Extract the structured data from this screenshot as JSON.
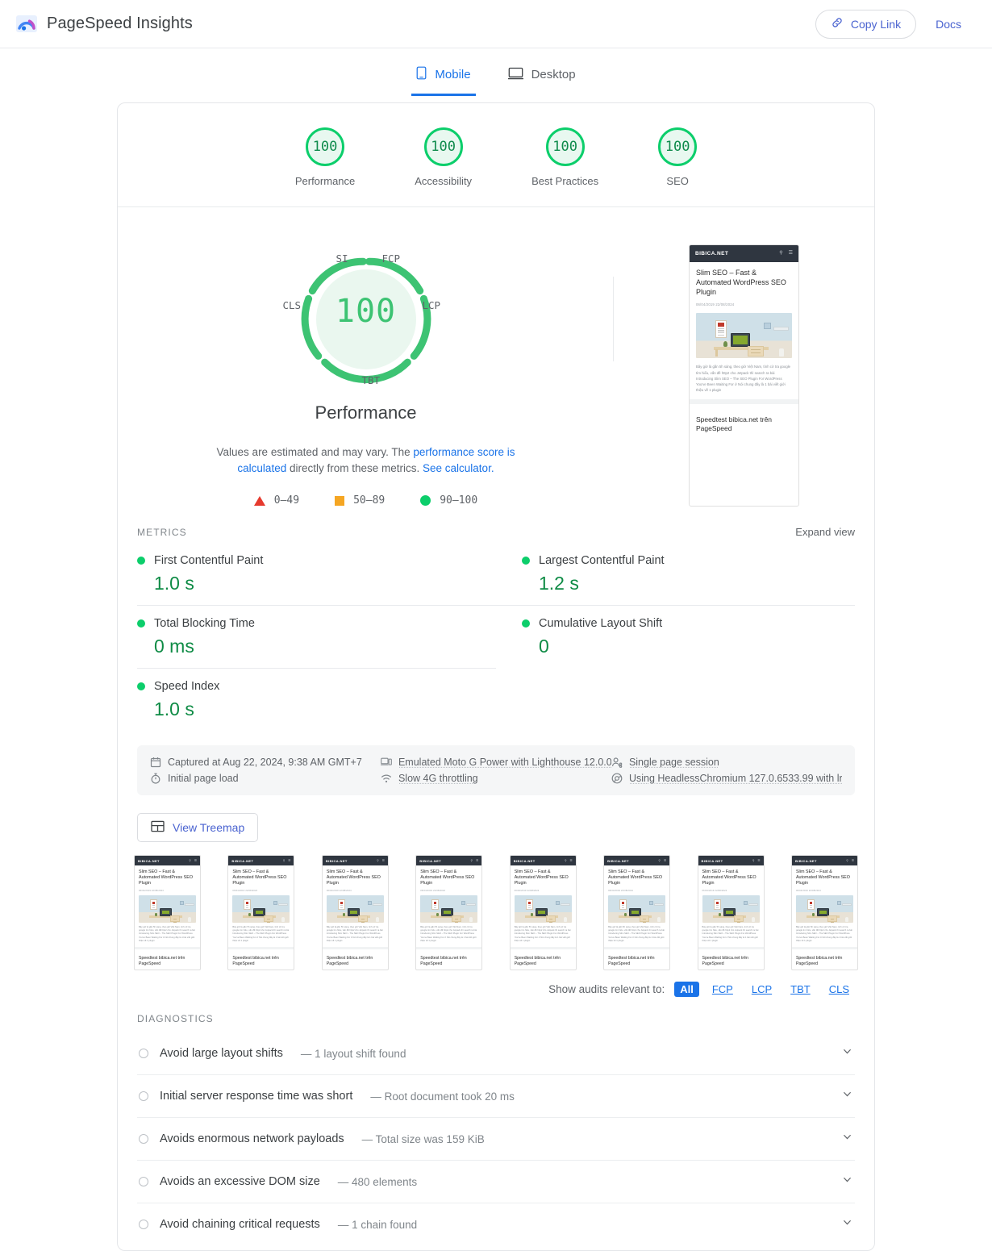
{
  "header": {
    "app_title": "PageSpeed Insights",
    "logo_icon": "pagespeed-logo-icon",
    "copy_link_label": "Copy Link",
    "copy_link_icon": "link-icon",
    "docs_label": "Docs"
  },
  "device_tabs": [
    {
      "label": "Mobile",
      "icon": "mobile-phone-icon",
      "active": true
    },
    {
      "label": "Desktop",
      "icon": "desktop-monitor-icon",
      "active": false
    }
  ],
  "category_scores": [
    {
      "label": "Performance",
      "score": "100"
    },
    {
      "label": "Accessibility",
      "score": "100"
    },
    {
      "label": "Best Practices",
      "score": "100"
    },
    {
      "label": "SEO",
      "score": "100"
    }
  ],
  "performance_gauge": {
    "score": "100",
    "title": "Performance",
    "arc_labels": {
      "si": "SI",
      "fcp": "FCP",
      "lcp": "LCP",
      "tbt": "TBT",
      "cls": "CLS"
    },
    "note_prefix": "Values are estimated and may vary. The ",
    "note_link1": "performance score is calculated",
    "note_middle": " directly from these metrics. ",
    "note_link2": "See calculator.",
    "legend": [
      {
        "symbol": "triangle",
        "range": "0–49",
        "color": "#e63a2e"
      },
      {
        "symbol": "square",
        "range": "50–89",
        "color": "#f5a623"
      },
      {
        "symbol": "circle",
        "range": "90–100",
        "color": "#0cce6b"
      }
    ]
  },
  "site_thumbnail": {
    "brand": "BIBICA.NET",
    "search_icon": "search-icon",
    "menu_icon": "hamburger-menu-icon",
    "title": "Slim SEO – Fast & Automated WordPress SEO Plugin",
    "meta": "06/04/2019  22/08/2024",
    "excerpt": "Bây giờ là gần 5h sáng, theo giờ Việt Nam, tình cờ tra google tìm hiểu, vấn đề http2 cho Jetpack thì search ra bài Introducing Slim SEO – The SEO Plugin For WordPress You've Been Waiting For ớ Nói chung đây là 1 bài viết giới thiệu về 1 plugin",
    "footer": "Speedtest bibica.net trên PageSpeed"
  },
  "metrics": {
    "section_label": "METRICS",
    "expand_view_label": "Expand view",
    "items": [
      {
        "name": "First Contentful Paint",
        "value": "1.0 s",
        "status": "good"
      },
      {
        "name": "Largest Contentful Paint",
        "value": "1.2 s",
        "status": "good"
      },
      {
        "name": "Total Blocking Time",
        "value": "0 ms",
        "status": "good"
      },
      {
        "name": "Cumulative Layout Shift",
        "value": "0",
        "status": "good"
      },
      {
        "name": "Speed Index",
        "value": "1.0 s",
        "status": "good"
      }
    ]
  },
  "environment": [
    {
      "icon": "calendar-icon",
      "text": "Captured at Aug 22, 2024, 9:38 AM GMT+7",
      "underlined": false
    },
    {
      "icon": "device-icon",
      "text": "Emulated Moto G Power with Lighthouse 12.0.0",
      "underlined": true
    },
    {
      "icon": "single-session-icon",
      "text": "Single page session",
      "underlined": true
    },
    {
      "icon": "stopwatch-icon",
      "text": "Initial page load",
      "underlined": false
    },
    {
      "icon": "network-icon",
      "text": "Slow 4G throttling",
      "underlined": true
    },
    {
      "icon": "chromium-icon",
      "text": "Using HeadlessChromium 127.0.6533.99 with lr",
      "underlined": true
    }
  ],
  "treemap": {
    "label": "View Treemap",
    "icon": "treemap-icon"
  },
  "filmstrip_count": 8,
  "audit_filter": {
    "label": "Show audits relevant to:",
    "chips": [
      {
        "label": "All",
        "active": true
      },
      {
        "label": "FCP",
        "active": false
      },
      {
        "label": "LCP",
        "active": false
      },
      {
        "label": "TBT",
        "active": false
      },
      {
        "label": "CLS",
        "active": false
      }
    ]
  },
  "diagnostics": {
    "section_label": "DIAGNOSTICS",
    "items": [
      {
        "title": "Avoid large layout shifts",
        "detail": "— 1 layout shift found"
      },
      {
        "title": "Initial server response time was short",
        "detail": "— Root document took 20 ms"
      },
      {
        "title": "Avoids enormous network payloads",
        "detail": "— Total size was 159 KiB"
      },
      {
        "title": "Avoids an excessive DOM size",
        "detail": "— 480 elements"
      },
      {
        "title": "Avoid chaining critical requests",
        "detail": "— 1 chain found"
      }
    ]
  },
  "colors": {
    "pass_green": "#0cce6b",
    "value_green": "#0e8b45",
    "accent_blue": "#1a73e8",
    "link_blue": "#4a63d0",
    "average_orange": "#f5a623",
    "fail_red": "#e63a2e"
  }
}
